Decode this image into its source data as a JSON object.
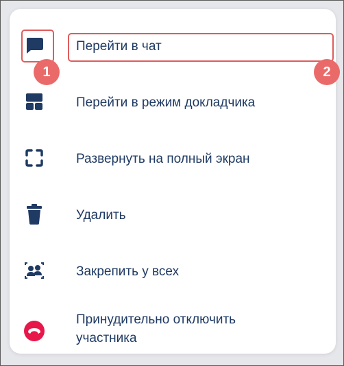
{
  "menu": {
    "items": [
      {
        "label": "Перейти в чат",
        "icon": "chat-icon"
      },
      {
        "label": "Перейти в режим докладчика",
        "icon": "presenter-icon"
      },
      {
        "label": "Развернуть на полный экран",
        "icon": "fullscreen-icon"
      },
      {
        "label": "Удалить",
        "icon": "trash-icon"
      },
      {
        "label": "Закрепить у всех",
        "icon": "pin-all-icon"
      },
      {
        "label_line1": "Принудительно отключить",
        "label_line2": "участника",
        "icon": "hangup-icon"
      }
    ]
  },
  "annotations": {
    "badge1": "1",
    "badge2": "2"
  },
  "colors": {
    "text": "#1f3a63",
    "icon": "#1f3a63",
    "highlight": "#e05b5b",
    "badge": "#ea6a6a",
    "danger": "#e8174a"
  }
}
